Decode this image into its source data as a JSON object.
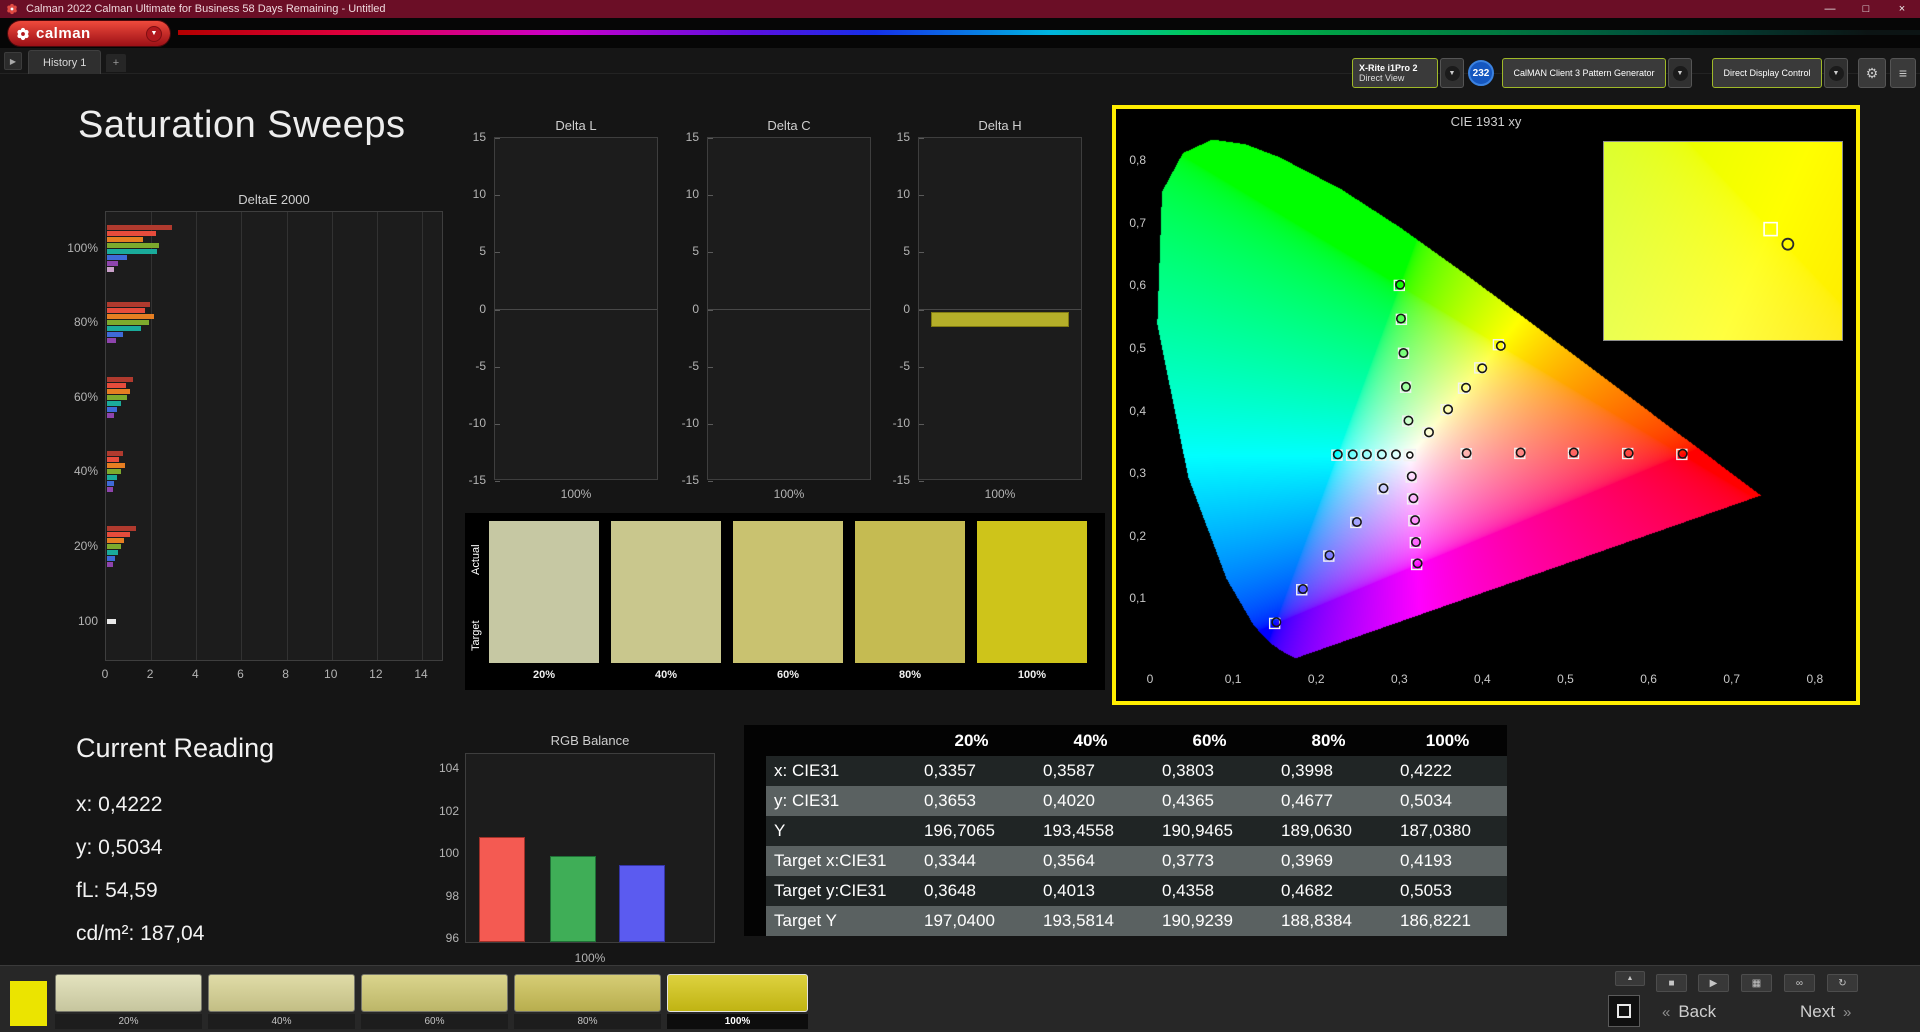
{
  "window": {
    "title": "Calman 2022 Calman Ultimate for Business 58 Days Remaining  - Untitled",
    "minimize_icon": "—",
    "maximize_icon": "□",
    "close_icon": "×"
  },
  "logo": {
    "text": "calman",
    "dropdown_icon": "▼"
  },
  "tab_bar": {
    "nav_icon": "▶",
    "history_tab": "History 1",
    "add_tab": "+"
  },
  "meter_bar": {
    "meter_line1": "X-Rite i1Pro 2",
    "meter_line2": "Direct View",
    "badge": "232",
    "source_label": "CalMAN Client 3 Pattern Generator",
    "display_label": "Direct Display Control",
    "dropdown_icon": "▼",
    "gear_icon": "⚙",
    "menu_icon": "≡"
  },
  "page_title": "Saturation Sweeps",
  "current_reading": {
    "heading": "Current Reading",
    "lines": [
      "x: 0,4222",
      "y: 0,5034",
      "fL: 54,59",
      "cd/m²: 187,04"
    ]
  },
  "swatch_panel": {
    "row_labels": [
      "Actual",
      "Target"
    ],
    "items": [
      {
        "label": "20%",
        "color": "#c6c8a3"
      },
      {
        "label": "40%",
        "color": "#c9c78d"
      },
      {
        "label": "60%",
        "color": "#c9c270"
      },
      {
        "label": "80%",
        "color": "#c5bb52"
      },
      {
        "label": "100%",
        "color": "#cec41a"
      }
    ]
  },
  "table": {
    "headers": [
      "20%",
      "40%",
      "60%",
      "80%",
      "100%"
    ],
    "rows": [
      {
        "label": "x: CIE31",
        "values": [
          "0,3357",
          "0,3587",
          "0,3803",
          "0,3998",
          "0,4222"
        ]
      },
      {
        "label": "y: CIE31",
        "values": [
          "0,3653",
          "0,4020",
          "0,4365",
          "0,4677",
          "0,5034"
        ]
      },
      {
        "label": "Y",
        "values": [
          "196,7065",
          "193,4558",
          "190,9465",
          "189,0630",
          "187,0380"
        ]
      },
      {
        "label": "Target x:CIE31",
        "values": [
          "0,3344",
          "0,3564",
          "0,3773",
          "0,3969",
          "0,4193"
        ]
      },
      {
        "label": "Target y:CIE31",
        "values": [
          "0,3648",
          "0,4013",
          "0,4358",
          "0,4682",
          "0,5053"
        ]
      },
      {
        "label": "Target Y",
        "values": [
          "197,0400",
          "193,5814",
          "190,9239",
          "188,8384",
          "186,8221"
        ]
      }
    ]
  },
  "bottom_bar": {
    "active_swatch_color": "#ebe400",
    "swatches": [
      {
        "label": "20%",
        "color": "#dddcb0",
        "selected": false
      },
      {
        "label": "40%",
        "color": "#d9d494",
        "selected": false
      },
      {
        "label": "60%",
        "color": "#d2cb74",
        "selected": false
      },
      {
        "label": "80%",
        "color": "#cdc257",
        "selected": false
      },
      {
        "label": "100%",
        "color": "#d6c815",
        "selected": true
      }
    ],
    "controls": {
      "up_icon": "▲",
      "stop_icon": "■",
      "play_icon": "▶",
      "save_icon": "▦",
      "link_icon": "∞",
      "loop_icon": "↻",
      "back_chevron": "«",
      "back_label": "Back",
      "next_label": "Next",
      "next_chevron": "»"
    }
  },
  "chart_data": {
    "deltae2000": {
      "type": "bar",
      "title": "DeltaE 2000",
      "xlim": [
        0,
        14
      ],
      "x_ticks": [
        0,
        2,
        4,
        6,
        8,
        10,
        12,
        14
      ],
      "groups": [
        {
          "label": "100%",
          "bars": [
            {
              "v": 2.9,
              "c": "#b03a2e"
            },
            {
              "v": 2.15,
              "c": "#e74c3c"
            },
            {
              "v": 1.6,
              "c": "#e67e22"
            },
            {
              "v": 2.3,
              "c": "#7daa2d"
            },
            {
              "v": 2.2,
              "c": "#1aab9b"
            },
            {
              "v": 0.9,
              "c": "#3f6ad8"
            },
            {
              "v": 0.5,
              "c": "#8e44ad"
            },
            {
              "v": 0.3,
              "c": "#c9a0c9"
            }
          ]
        },
        {
          "label": "80%",
          "bars": [
            {
              "v": 1.9,
              "c": "#b03a2e"
            },
            {
              "v": 1.7,
              "c": "#e74c3c"
            },
            {
              "v": 2.1,
              "c": "#e67e22"
            },
            {
              "v": 1.85,
              "c": "#7daa2d"
            },
            {
              "v": 1.5,
              "c": "#1aab9b"
            },
            {
              "v": 0.7,
              "c": "#3f6ad8"
            },
            {
              "v": 0.4,
              "c": "#8e44ad"
            }
          ]
        },
        {
          "label": "60%",
          "bars": [
            {
              "v": 1.15,
              "c": "#b03a2e"
            },
            {
              "v": 0.85,
              "c": "#e74c3c"
            },
            {
              "v": 1.0,
              "c": "#e67e22"
            },
            {
              "v": 0.9,
              "c": "#7daa2d"
            },
            {
              "v": 0.6,
              "c": "#1aab9b"
            },
            {
              "v": 0.45,
              "c": "#3f6ad8"
            },
            {
              "v": 0.3,
              "c": "#8e44ad"
            }
          ]
        },
        {
          "label": "40%",
          "bars": [
            {
              "v": 0.7,
              "c": "#b03a2e"
            },
            {
              "v": 0.55,
              "c": "#e74c3c"
            },
            {
              "v": 0.8,
              "c": "#e67e22"
            },
            {
              "v": 0.6,
              "c": "#7daa2d"
            },
            {
              "v": 0.45,
              "c": "#1aab9b"
            },
            {
              "v": 0.3,
              "c": "#3f6ad8"
            },
            {
              "v": 0.25,
              "c": "#8e44ad"
            }
          ]
        },
        {
          "label": "20%",
          "bars": [
            {
              "v": 1.3,
              "c": "#b03a2e"
            },
            {
              "v": 1.0,
              "c": "#e74c3c"
            },
            {
              "v": 0.75,
              "c": "#e67e22"
            },
            {
              "v": 0.6,
              "c": "#7daa2d"
            },
            {
              "v": 0.5,
              "c": "#1aab9b"
            },
            {
              "v": 0.35,
              "c": "#3f6ad8"
            },
            {
              "v": 0.25,
              "c": "#8e44ad"
            }
          ]
        },
        {
          "label": "100",
          "bars": [
            {
              "v": 0.4,
              "c": "#e8e8e8"
            }
          ]
        }
      ]
    },
    "delta_l": {
      "type": "bar",
      "title": "Delta L",
      "ylim": [
        -15,
        15
      ],
      "ticks": [
        15,
        10,
        5,
        0,
        -5,
        -10,
        -15
      ],
      "x_label": "100%",
      "bar": null
    },
    "delta_c": {
      "type": "bar",
      "title": "Delta C",
      "ylim": [
        -15,
        15
      ],
      "ticks": [
        15,
        10,
        5,
        0,
        -5,
        -10,
        -15
      ],
      "x_label": "100%",
      "bar": null
    },
    "delta_h": {
      "type": "bar",
      "title": "Delta H",
      "ylim": [
        -15,
        15
      ],
      "ticks": [
        15,
        10,
        5,
        0,
        -5,
        -10,
        -15
      ],
      "x_label": "100%",
      "bar": {
        "from": -0.2,
        "to": -1.5,
        "color": "#b4ae29",
        "border": "#807a12"
      }
    },
    "rgb_balance": {
      "type": "bar",
      "title": "RGB Balance",
      "ticks": [
        104,
        102,
        100,
        98,
        96
      ],
      "ylim": [
        95.8,
        104.7
      ],
      "x_label": "100%",
      "bars": [
        {
          "name": "red",
          "v": 100.8,
          "c": "#f45a52",
          "b": "#a03028"
        },
        {
          "name": "green",
          "v": 99.9,
          "c": "#3fae57",
          "b": "#1f7036"
        },
        {
          "name": "blue",
          "v": 99.5,
          "c": "#5b5bf0",
          "b": "#3434a8"
        }
      ]
    },
    "cie": {
      "type": "scatter",
      "title": "CIE 1931 xy",
      "x_ticks": [
        "0",
        "0,1",
        "0,2",
        "0,3",
        "0,4",
        "0,5",
        "0,6",
        "0,7",
        "0,8"
      ],
      "y_ticks": [
        "0,1",
        "0,2",
        "0,3",
        "0,4",
        "0,5",
        "0,6",
        "0,7",
        "0,8"
      ],
      "white_point": [
        0.3127,
        0.329
      ],
      "locus": [
        [
          0.1741,
          0.005
        ],
        [
          0.1566,
          0.0177
        ],
        [
          0.144,
          0.0297
        ],
        [
          0.1241,
          0.0578
        ],
        [
          0.0913,
          0.1327
        ],
        [
          0.0454,
          0.295
        ],
        [
          0.0082,
          0.5384
        ],
        [
          0.0139,
          0.7502
        ],
        [
          0.0389,
          0.812
        ],
        [
          0.0743,
          0.8338
        ],
        [
          0.1142,
          0.8262
        ],
        [
          0.1547,
          0.8059
        ],
        [
          0.2296,
          0.7543
        ],
        [
          0.3016,
          0.6923
        ],
        [
          0.3731,
          0.6245
        ],
        [
          0.4441,
          0.5547
        ],
        [
          0.5125,
          0.4866
        ],
        [
          0.5752,
          0.4242
        ],
        [
          0.627,
          0.3725
        ],
        [
          0.6658,
          0.334
        ],
        [
          0.6915,
          0.3083
        ],
        [
          0.719,
          0.2809
        ],
        [
          0.7347,
          0.2653
        ]
      ],
      "targets": [
        [
          0.3805,
          0.3312
        ],
        [
          0.445,
          0.3316
        ],
        [
          0.5096,
          0.3317
        ],
        [
          0.5748,
          0.3314
        ],
        [
          0.64,
          0.33
        ],
        [
          0.3102,
          0.3832
        ],
        [
          0.3076,
          0.4374
        ],
        [
          0.3051,
          0.4916
        ],
        [
          0.3025,
          0.5458
        ],
        [
          0.3,
          0.6
        ],
        [
          0.2802,
          0.2752
        ],
        [
          0.2477,
          0.2214
        ],
        [
          0.2152,
          0.1676
        ],
        [
          0.1826,
          0.1138
        ],
        [
          0.15,
          0.06
        ],
        [
          0.3344,
          0.3648
        ],
        [
          0.3564,
          0.4013
        ],
        [
          0.3773,
          0.4358
        ],
        [
          0.3969,
          0.4682
        ],
        [
          0.4193,
          0.5053
        ],
        [
          0.2951,
          0.329
        ],
        [
          0.2776,
          0.3289
        ],
        [
          0.2601,
          0.3289
        ],
        [
          0.2426,
          0.3288
        ],
        [
          0.225,
          0.3288
        ],
        [
          0.3143,
          0.294
        ],
        [
          0.316,
          0.259
        ],
        [
          0.3176,
          0.2241
        ],
        [
          0.3193,
          0.1891
        ],
        [
          0.3209,
          0.1542
        ]
      ],
      "measured": [
        [
          0.381,
          0.332
        ],
        [
          0.446,
          0.333
        ],
        [
          0.51,
          0.333
        ],
        [
          0.576,
          0.332
        ],
        [
          0.641,
          0.331
        ],
        [
          0.311,
          0.384
        ],
        [
          0.308,
          0.438
        ],
        [
          0.305,
          0.492
        ],
        [
          0.302,
          0.547
        ],
        [
          0.301,
          0.601
        ],
        [
          0.281,
          0.276
        ],
        [
          0.249,
          0.222
        ],
        [
          0.216,
          0.169
        ],
        [
          0.184,
          0.115
        ],
        [
          0.152,
          0.062
        ],
        [
          0.3357,
          0.3653
        ],
        [
          0.3587,
          0.402
        ],
        [
          0.3803,
          0.4365
        ],
        [
          0.3998,
          0.4677
        ],
        [
          0.4222,
          0.5034
        ],
        [
          0.296,
          0.33
        ],
        [
          0.279,
          0.33
        ],
        [
          0.261,
          0.33
        ],
        [
          0.244,
          0.33
        ],
        [
          0.226,
          0.33
        ],
        [
          0.315,
          0.295
        ],
        [
          0.317,
          0.26
        ],
        [
          0.319,
          0.225
        ],
        [
          0.32,
          0.19
        ],
        [
          0.322,
          0.156
        ]
      ],
      "inset": {
        "xmin": 0.3913,
        "xmax": 0.4313,
        "ymin": 0.4913,
        "ymax": 0.5163,
        "target": [
          0.4193,
          0.5053
        ],
        "measured": [
          0.4222,
          0.5034
        ]
      }
    }
  }
}
